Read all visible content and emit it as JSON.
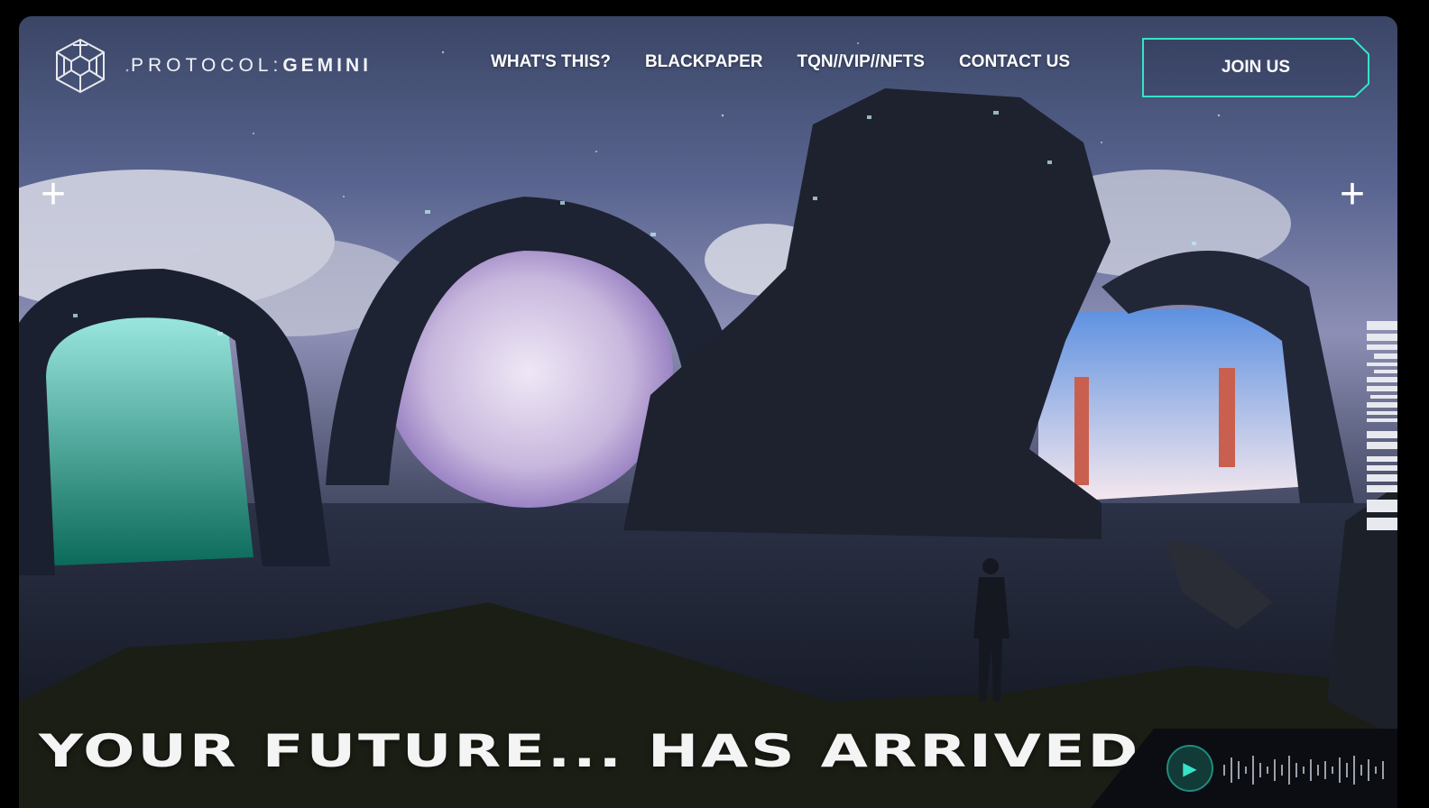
{
  "brand": {
    "light": "PROTOCOL:",
    "bold": "GEMINI"
  },
  "nav": {
    "items": [
      {
        "label": "WHAT'S THIS?"
      },
      {
        "label": "BLACKPAPER"
      },
      {
        "label": "TQN//VIP//NFTS"
      },
      {
        "label": "CONTACT US"
      }
    ]
  },
  "cta": {
    "join_label": "JOIN US"
  },
  "hero": {
    "title": "YOUR FUTURE... HAS ARRIVED"
  },
  "audio": {
    "icon": "play-icon"
  },
  "colors": {
    "accent": "#35e3c8",
    "background": "#000000"
  },
  "icons": [
    "logo-cube-icon",
    "plus-icon",
    "play-icon",
    "waveform-icon"
  ]
}
